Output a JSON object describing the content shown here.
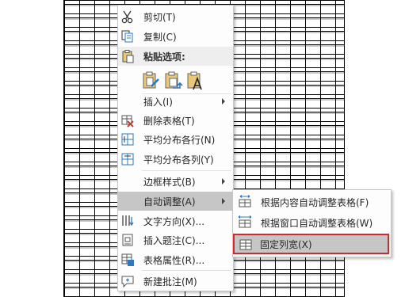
{
  "context_menu": {
    "cut": "剪切(T)",
    "copy": "复制(C)",
    "paste_options_header": "粘贴选项:",
    "insert": "插入(I)",
    "delete_table": "删除表格(T)",
    "distribute_rows": "平均分布各行(N)",
    "distribute_columns": "平均分布各列(Y)",
    "border_styles": "边框样式(B)",
    "autofit": "自动调整(A)",
    "text_direction": "文字方向(X)...",
    "insert_caption": "插入题注(C)...",
    "table_properties": "表格属性(R)...",
    "new_comment": "新建批注(M)"
  },
  "autofit_submenu": {
    "autofit_contents": "根据内容自动调整表格(F)",
    "autofit_window": "根据窗口自动调整表格(W)",
    "fixed_column_width": "固定列宽(X)"
  },
  "colors": {
    "highlight": "#c6c6c6",
    "annotation_border": "#d9262b",
    "accent_blue": "#2b78c5",
    "delete_red": "#d43a2a"
  }
}
